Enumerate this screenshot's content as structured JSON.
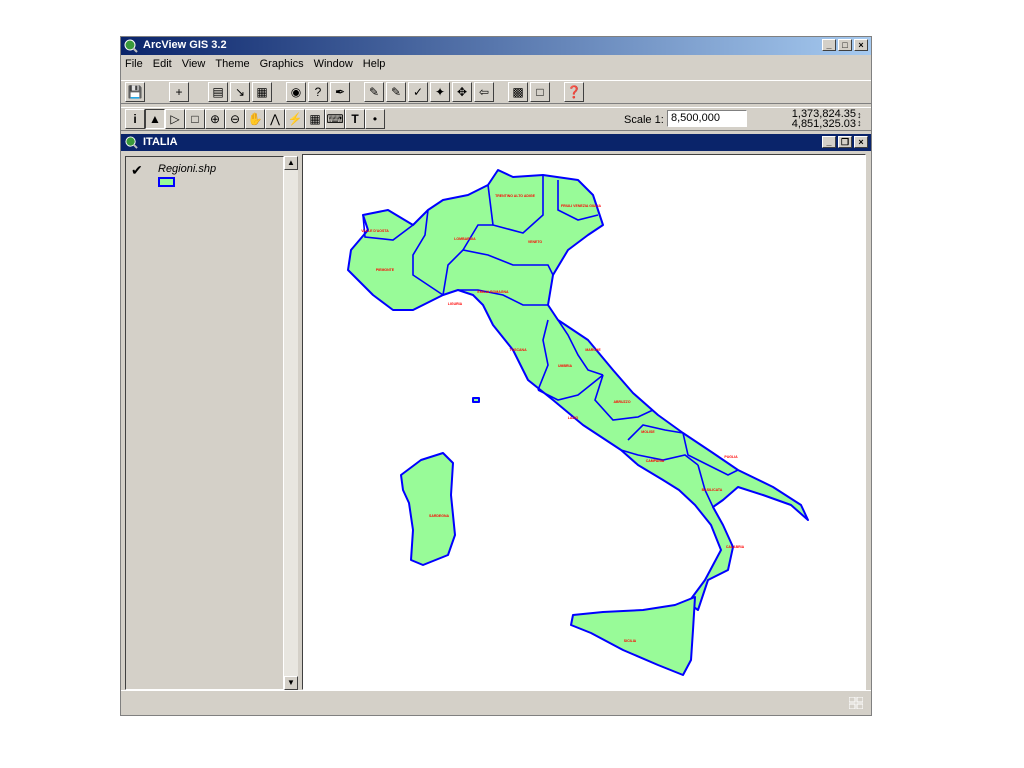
{
  "app": {
    "title": "ArcView GIS 3.2"
  },
  "menu": {
    "items": [
      {
        "label": "File"
      },
      {
        "label": "Edit"
      },
      {
        "label": "View"
      },
      {
        "label": "Theme"
      },
      {
        "label": "Graphics"
      },
      {
        "label": "Window"
      },
      {
        "label": "Help"
      }
    ]
  },
  "toolbar": {
    "scale_label": "Scale 1:",
    "scale_value": "8,500,000",
    "coord_x": "1,373,824.35",
    "coord_y": "4,851,325.03"
  },
  "view": {
    "title": "ITALIA"
  },
  "toc": {
    "theme_name": "Regioni.shp",
    "checked": true
  },
  "map": {
    "fill_color": "#98fb98",
    "outline_color": "#0000ff",
    "label_color": "#ff0000",
    "regions": [
      "TRENTINO ALTO ADIGE",
      "FRIULI VENEZIA GIULIA",
      "VALLE D'AOSTA",
      "LOMBARDIA",
      "VENETO",
      "PIEMONTE",
      "EMILIA ROMAGNA",
      "LIGURIA",
      "TOSCANA",
      "MARCHE",
      "UMBRIA",
      "LAZIO",
      "ABRUZZO",
      "MOLISE",
      "CAMPANIA",
      "PUGLIA",
      "BASILICATA",
      "CALABRIA",
      "SARDEGNA",
      "SICILIA"
    ]
  },
  "colors": {
    "titlebar": "#0a246a",
    "chrome": "#d4d0c8"
  }
}
